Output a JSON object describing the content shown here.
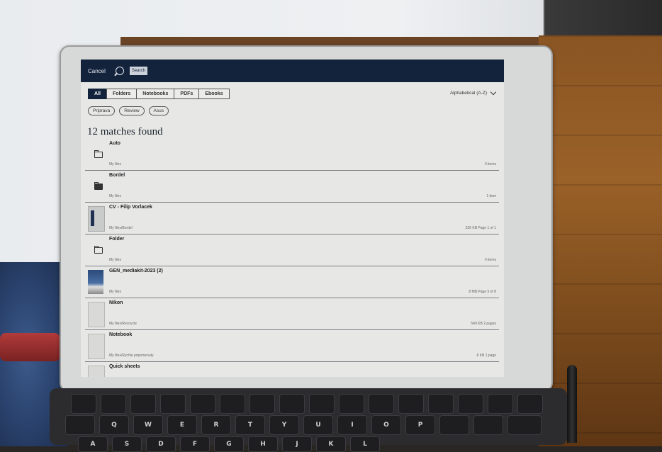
{
  "app": {
    "cancel_label": "Cancel",
    "search_placeholder": "Search"
  },
  "tabs": [
    {
      "label": "All",
      "active": true
    },
    {
      "label": "Folders",
      "active": false
    },
    {
      "label": "Notebooks",
      "active": false
    },
    {
      "label": "PDFs",
      "active": false
    },
    {
      "label": "Ebooks",
      "active": false
    }
  ],
  "sort": {
    "label": "Alphabetical (A-Z)"
  },
  "chips": [
    "Priprava",
    "Review",
    "Asus"
  ],
  "results_heading": "12 matches found",
  "results": [
    {
      "title": "Auto",
      "path": "My files",
      "meta": "0 items",
      "icon": "folder-icon"
    },
    {
      "title": "Bordel",
      "path": "My files",
      "meta": "1 item",
      "icon": "folder-filled-icon"
    },
    {
      "title": "CV - Filip Vorlacek",
      "path": "My files/Bordel",
      "meta": "226 KB  Page 1 of 1",
      "icon": "document-thumbnail"
    },
    {
      "title": "Folder",
      "path": "My files",
      "meta": "0 items",
      "icon": "folder-icon"
    },
    {
      "title": "GEN_mediakit-2023 (2)",
      "path": "My files",
      "meta": "8 MB  Page 5 of 8",
      "icon": "magazine-thumbnail"
    },
    {
      "title": "Nikon",
      "path": "My files/Recovcle",
      "meta": "540 KB  2 pages",
      "icon": "notebook-thumbnail"
    },
    {
      "title": "Notebook",
      "path": "My files/Rychle pripomenuty",
      "meta": "8 KB  1 page",
      "icon": "notebook-thumbnail"
    },
    {
      "title": "Quick sheets",
      "path": "",
      "meta": "",
      "icon": "notebook-thumbnail"
    }
  ],
  "keyboard": {
    "row2": [
      "Q",
      "W",
      "E",
      "R",
      "T",
      "Y",
      "U",
      "I",
      "O",
      "P"
    ],
    "row3": [
      "A",
      "S",
      "D",
      "F",
      "G",
      "H",
      "J",
      "K",
      "L"
    ]
  },
  "colors": {
    "accent": "#13233c",
    "screen": "#e7e8e6"
  }
}
